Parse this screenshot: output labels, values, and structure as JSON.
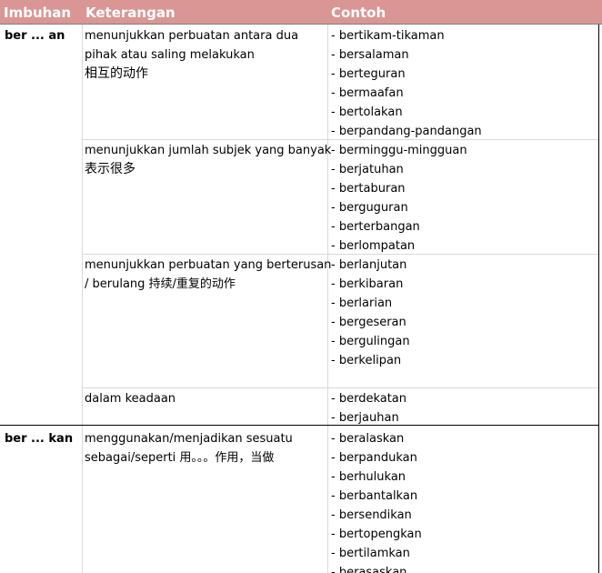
{
  "header": {
    "col1": "Imbuhan",
    "col2": "Keterangan",
    "col3": "Contoh"
  },
  "colors": {
    "header_bg": "#da9694",
    "header_text": "#ffffff",
    "grid": "#d9d9d9"
  },
  "groups": [
    {
      "imbuhan": "ber ... an",
      "rows": [
        {
          "ket": [
            "menunjukkan perbuatan antara dua",
            "pihak atau saling melakukan",
            "相互的动作"
          ],
          "contoh": [
            "- bertikam-tikaman",
            "- bersalaman",
            "- berteguran",
            "- bermaafan",
            "- bertolakan",
            "- berpandang-pandangan"
          ]
        },
        {
          "ket": [
            "menunjukkan jumlah subjek yang banyak",
            "表示很多"
          ],
          "contoh": [
            "- berminggu-mingguan",
            "- berjatuhan",
            "- bertaburan",
            "- berguguran",
            "- berterbangan",
            "- berlompatan"
          ]
        },
        {
          "ket": [
            "menunjukkan perbuatan yang berterusan",
            "/ berulang 持续/重复的动作"
          ],
          "contoh": [
            "- berlanjutan",
            "- berkibaran",
            "- berlarian",
            "- bergeseran",
            "- bergulingan",
            "- berkelipan"
          ]
        },
        {
          "ket": [
            "dalam keadaan"
          ],
          "contoh": [
            "- berdekatan",
            "- berjauhan"
          ]
        }
      ]
    },
    {
      "imbuhan": "ber ... kan",
      "rows": [
        {
          "ket": [
            "menggunakan/menjadikan sesuatu",
            "sebagai/seperti 用。。。作用，当做"
          ],
          "contoh": [
            "- beralaskan",
            "- berpandukan",
            "- berhulukan",
            "- berbantalkan",
            "- bersendikan",
            "- bertopengkan",
            "- bertilamkan",
            "- berasaskan"
          ]
        }
      ]
    }
  ]
}
